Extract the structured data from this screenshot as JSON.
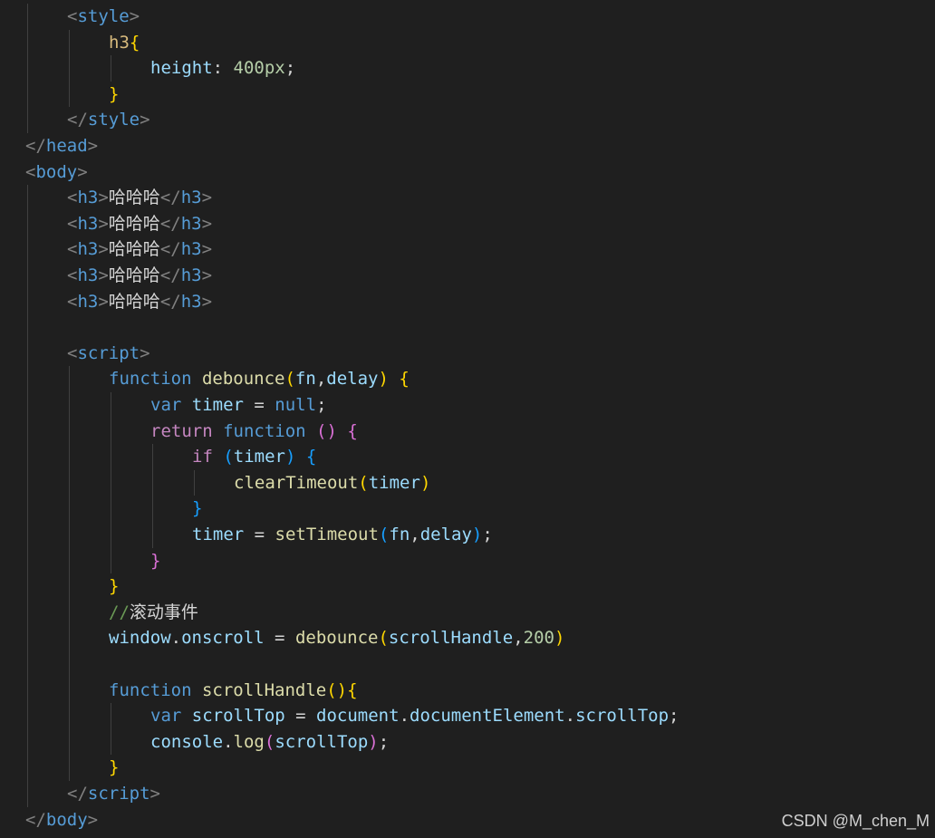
{
  "colors": {
    "background": "#1f1f1f",
    "tag": "#569cd6",
    "bracket": "#808080",
    "property": "#9cdcfe",
    "number": "#b5cea8",
    "selector": "#d7ba7d",
    "function_name": "#dcdcaa",
    "keyword": "#569cd6",
    "control": "#c586c0",
    "comment": "#6a9955",
    "brace_level1": "#ffd700",
    "brace_level2": "#da70d6",
    "brace_level3": "#179fff"
  },
  "code_lines": [
    {
      "indent": 1,
      "tokens": [
        [
          "bracket",
          "<"
        ],
        [
          "tag",
          "style"
        ],
        [
          "bracket",
          ">"
        ]
      ]
    },
    {
      "indent": 2,
      "tokens": [
        [
          "selector",
          "h3"
        ],
        [
          "brace1",
          "{"
        ]
      ]
    },
    {
      "indent": 3,
      "tokens": [
        [
          "prop",
          "height"
        ],
        [
          "plain",
          ": "
        ],
        [
          "num",
          "400px"
        ],
        [
          "plain",
          ";"
        ]
      ]
    },
    {
      "indent": 2,
      "tokens": [
        [
          "brace1",
          "}"
        ]
      ]
    },
    {
      "indent": 1,
      "tokens": [
        [
          "bracket",
          "</"
        ],
        [
          "tag",
          "style"
        ],
        [
          "bracket",
          ">"
        ]
      ]
    },
    {
      "indent": 0,
      "tokens": [
        [
          "bracket",
          "</"
        ],
        [
          "tag",
          "head"
        ],
        [
          "bracket",
          ">"
        ]
      ]
    },
    {
      "indent": 0,
      "tokens": [
        [
          "bracket",
          "<"
        ],
        [
          "tag",
          "body"
        ],
        [
          "bracket",
          ">"
        ]
      ]
    },
    {
      "indent": 1,
      "tokens": [
        [
          "bracket",
          "<"
        ],
        [
          "tag",
          "h3"
        ],
        [
          "bracket",
          ">"
        ],
        [
          "cjk",
          "哈哈哈"
        ],
        [
          "bracket",
          "</"
        ],
        [
          "tag",
          "h3"
        ],
        [
          "bracket",
          ">"
        ]
      ]
    },
    {
      "indent": 1,
      "tokens": [
        [
          "bracket",
          "<"
        ],
        [
          "tag",
          "h3"
        ],
        [
          "bracket",
          ">"
        ],
        [
          "cjk",
          "哈哈哈"
        ],
        [
          "bracket",
          "</"
        ],
        [
          "tag",
          "h3"
        ],
        [
          "bracket",
          ">"
        ]
      ]
    },
    {
      "indent": 1,
      "tokens": [
        [
          "bracket",
          "<"
        ],
        [
          "tag",
          "h3"
        ],
        [
          "bracket",
          ">"
        ],
        [
          "cjk",
          "哈哈哈"
        ],
        [
          "bracket",
          "</"
        ],
        [
          "tag",
          "h3"
        ],
        [
          "bracket",
          ">"
        ]
      ]
    },
    {
      "indent": 1,
      "tokens": [
        [
          "bracket",
          "<"
        ],
        [
          "tag",
          "h3"
        ],
        [
          "bracket",
          ">"
        ],
        [
          "cjk",
          "哈哈哈"
        ],
        [
          "bracket",
          "</"
        ],
        [
          "tag",
          "h3"
        ],
        [
          "bracket",
          ">"
        ]
      ]
    },
    {
      "indent": 1,
      "tokens": [
        [
          "bracket",
          "<"
        ],
        [
          "tag",
          "h3"
        ],
        [
          "bracket",
          ">"
        ],
        [
          "cjk",
          "哈哈哈"
        ],
        [
          "bracket",
          "</"
        ],
        [
          "tag",
          "h3"
        ],
        [
          "bracket",
          ">"
        ]
      ]
    },
    {
      "indent": 0,
      "tokens": []
    },
    {
      "indent": 1,
      "tokens": [
        [
          "bracket",
          "<"
        ],
        [
          "tag",
          "script"
        ],
        [
          "bracket",
          ">"
        ]
      ]
    },
    {
      "indent": 2,
      "tokens": [
        [
          "keyword",
          "function "
        ],
        [
          "func",
          "debounce"
        ],
        [
          "brace1",
          "("
        ],
        [
          "var",
          "fn"
        ],
        [
          "plain",
          ","
        ],
        [
          "var",
          "delay"
        ],
        [
          "brace1",
          ")"
        ],
        [
          "plain",
          " "
        ],
        [
          "brace1",
          "{"
        ]
      ]
    },
    {
      "indent": 3,
      "tokens": [
        [
          "keyword",
          "var "
        ],
        [
          "var",
          "timer"
        ],
        [
          "plain",
          " = "
        ],
        [
          "keyword",
          "null"
        ],
        [
          "plain",
          ";"
        ]
      ]
    },
    {
      "indent": 3,
      "tokens": [
        [
          "control",
          "return "
        ],
        [
          "keyword",
          "function "
        ],
        [
          "brace2",
          "()"
        ],
        [
          "plain",
          " "
        ],
        [
          "brace2",
          "{"
        ]
      ]
    },
    {
      "indent": 4,
      "tokens": [
        [
          "control",
          "if "
        ],
        [
          "brace3",
          "("
        ],
        [
          "var",
          "timer"
        ],
        [
          "brace3",
          ")"
        ],
        [
          "plain",
          " "
        ],
        [
          "brace3",
          "{"
        ]
      ]
    },
    {
      "indent": 5,
      "tokens": [
        [
          "func",
          "clearTimeout"
        ],
        [
          "brace1",
          "("
        ],
        [
          "var",
          "timer"
        ],
        [
          "brace1",
          ")"
        ]
      ]
    },
    {
      "indent": 4,
      "tokens": [
        [
          "brace3",
          "}"
        ]
      ]
    },
    {
      "indent": 4,
      "tokens": [
        [
          "var",
          "timer"
        ],
        [
          "plain",
          " = "
        ],
        [
          "func",
          "setTimeout"
        ],
        [
          "brace3",
          "("
        ],
        [
          "var",
          "fn"
        ],
        [
          "plain",
          ","
        ],
        [
          "var",
          "delay"
        ],
        [
          "brace3",
          ")"
        ],
        [
          "plain",
          ";"
        ]
      ]
    },
    {
      "indent": 3,
      "tokens": [
        [
          "brace2",
          "}"
        ]
      ]
    },
    {
      "indent": 2,
      "tokens": [
        [
          "brace1",
          "}"
        ]
      ]
    },
    {
      "indent": 2,
      "tokens": [
        [
          "comment",
          "//"
        ],
        [
          "commentcjk",
          "滚动事件"
        ]
      ]
    },
    {
      "indent": 2,
      "tokens": [
        [
          "var",
          "window"
        ],
        [
          "plain",
          "."
        ],
        [
          "var",
          "onscroll"
        ],
        [
          "plain",
          " = "
        ],
        [
          "func",
          "debounce"
        ],
        [
          "brace1",
          "("
        ],
        [
          "var",
          "scrollHandle"
        ],
        [
          "plain",
          ","
        ],
        [
          "num",
          "200"
        ],
        [
          "brace1",
          ")"
        ]
      ]
    },
    {
      "indent": 0,
      "tokens": []
    },
    {
      "indent": 2,
      "tokens": [
        [
          "keyword",
          "function "
        ],
        [
          "func",
          "scrollHandle"
        ],
        [
          "brace1",
          "(){"
        ]
      ]
    },
    {
      "indent": 3,
      "tokens": [
        [
          "keyword",
          "var "
        ],
        [
          "var",
          "scrollTop"
        ],
        [
          "plain",
          " = "
        ],
        [
          "var",
          "document"
        ],
        [
          "plain",
          "."
        ],
        [
          "var",
          "documentElement"
        ],
        [
          "plain",
          "."
        ],
        [
          "var",
          "scrollTop"
        ],
        [
          "plain",
          ";"
        ]
      ]
    },
    {
      "indent": 3,
      "tokens": [
        [
          "var",
          "console"
        ],
        [
          "plain",
          "."
        ],
        [
          "func",
          "log"
        ],
        [
          "brace2",
          "("
        ],
        [
          "var",
          "scrollTop"
        ],
        [
          "brace2",
          ")"
        ],
        [
          "plain",
          ";"
        ]
      ]
    },
    {
      "indent": 2,
      "tokens": [
        [
          "brace1",
          "}"
        ]
      ]
    },
    {
      "indent": 1,
      "tokens": [
        [
          "bracket",
          "</"
        ],
        [
          "tag",
          "script"
        ],
        [
          "bracket",
          ">"
        ]
      ]
    },
    {
      "indent": 0,
      "tokens": [
        [
          "bracket",
          "</"
        ],
        [
          "tag",
          "body"
        ],
        [
          "bracket",
          ">"
        ]
      ]
    }
  ],
  "watermark": "CSDN @M_chen_M"
}
